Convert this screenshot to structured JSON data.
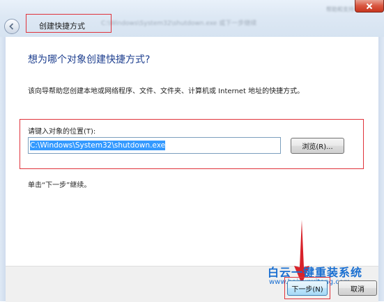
{
  "window": {
    "title": "创建快捷方式",
    "blurred_path_text": "C:\\Windows\\System32\\shutdown.exe  或下一步继续",
    "blurred_corner_text": "帮助和支持"
  },
  "page": {
    "heading": "想为哪个对象创建快捷方式?",
    "description": "该向导帮助您创建本地或网络程序、文件、文件夹、计算机或 Internet 地址的快捷方式。",
    "location_label": "请键入对象的位置(T):",
    "location_value": "C:\\Windows\\System32\\shutdown.exe",
    "browse_label": "浏览(R)...",
    "note": "单击“下一步”继续。"
  },
  "footer": {
    "next_label": "下一步(N)",
    "cancel_label": "取消"
  },
  "watermark": {
    "title": "白云一键重装系统",
    "url": "www.baiyunxitong.com"
  },
  "colors": {
    "highlight_red": "#e0323a",
    "heading_blue": "#1e3f8f",
    "selection_blue": "#3399ff",
    "watermark_blue": "#1a6fd1"
  },
  "icons": {
    "back": "back-arrow-icon",
    "close": "close-icon",
    "annotation_arrow": "down-arrow-icon"
  }
}
